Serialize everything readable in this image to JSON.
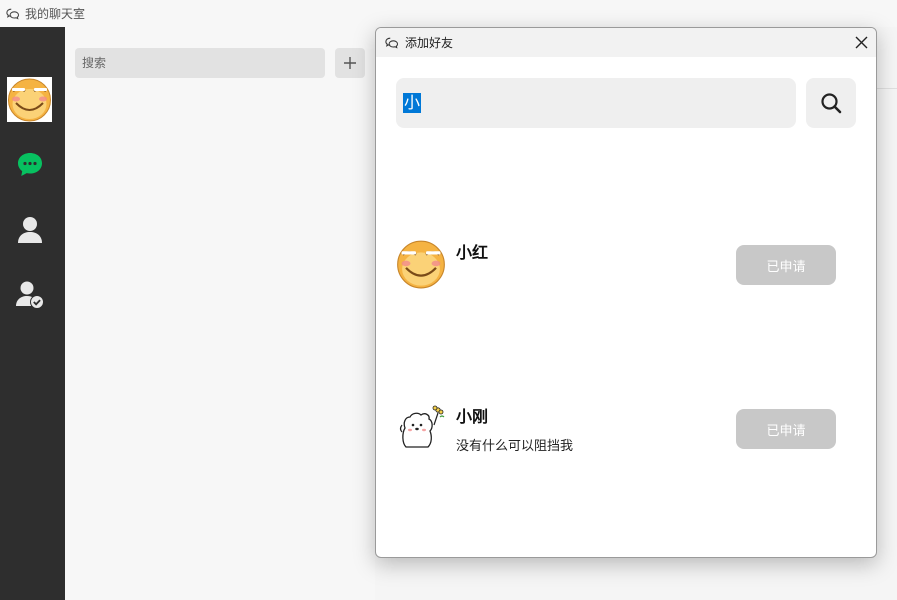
{
  "window": {
    "title": "我的聊天室",
    "icon": "chat-bubbles-icon"
  },
  "sidebar": {
    "avatar": "smiley-face-avatar",
    "items": [
      {
        "name": "chat",
        "icon": "chat-bubble-icon",
        "color": "#07c160"
      },
      {
        "name": "contacts",
        "icon": "person-icon"
      },
      {
        "name": "friend-requests",
        "icon": "person-check-icon"
      }
    ]
  },
  "contact_list": {
    "search_placeholder": "搜索",
    "add_icon": "plus-icon"
  },
  "add_friend_dialog": {
    "title": "添加好友",
    "search_value": "小",
    "search_icon": "search-icon",
    "close_icon": "close-icon",
    "results": [
      {
        "name": "小红",
        "signature": "",
        "avatar": "smiley-face-avatar",
        "button_label": "已申请"
      },
      {
        "name": "小刚",
        "signature": "没有什么可以阻挡我",
        "avatar": "cartoon-dog-avatar",
        "button_label": "已申请"
      }
    ]
  },
  "colors": {
    "sidebar_bg": "#2e2e2e",
    "chat_green": "#07c160",
    "selection_blue": "#0078d7",
    "applied_button_bg": "#c8c8c8"
  }
}
